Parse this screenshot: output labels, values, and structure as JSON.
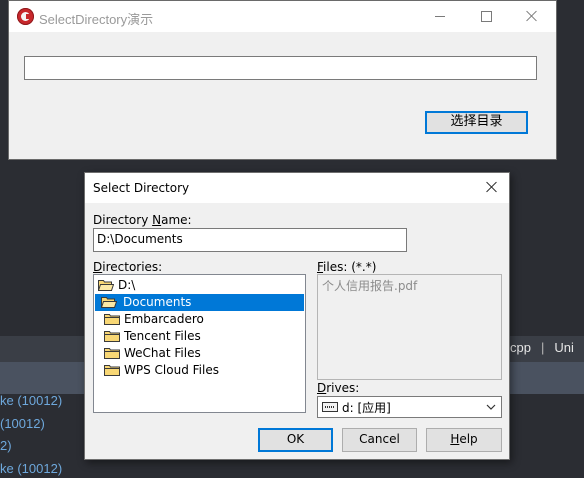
{
  "main_window": {
    "title": "SelectDirectory演示",
    "edit_value": "",
    "button_label": "选择目录"
  },
  "dialog": {
    "title": "Select Directory",
    "directory_name_label": {
      "pre": "Directory ",
      "key": "N",
      "post": "ame:"
    },
    "directory_name_value": "D:\\Documents",
    "directories_label": {
      "key": "D",
      "post": "irectories:"
    },
    "files_label": {
      "key": "F",
      "post": "iles: (*.*)"
    },
    "directories": [
      {
        "label": "D:\\",
        "icon": "open-folder-icon",
        "level": 0,
        "selected": false
      },
      {
        "label": "Documents",
        "icon": "open-folder-icon",
        "level": 1,
        "selected": true
      },
      {
        "label": "Embarcadero",
        "icon": "folder-icon",
        "level": 1,
        "selected": false
      },
      {
        "label": "Tencent Files",
        "icon": "folder-icon",
        "level": 1,
        "selected": false
      },
      {
        "label": "WeChat Files",
        "icon": "folder-icon",
        "level": 1,
        "selected": false
      },
      {
        "label": "WPS Cloud Files",
        "icon": "folder-icon",
        "level": 1,
        "selected": false
      }
    ],
    "files": [
      "个人信用报告.pdf"
    ],
    "drives_label": {
      "key": "D",
      "post": "rives:"
    },
    "drive_value": "d: [应用]",
    "ok_label": "OK",
    "cancel_label": "Cancel",
    "help_label": {
      "key": "H",
      "post": "elp"
    }
  },
  "background": {
    "tabs": [
      "cpp",
      "Uni"
    ],
    "list": [
      "ke (10012)",
      "(10012)",
      "2)",
      "ke (10012)"
    ]
  },
  "colors": {
    "accent": "#0078d7",
    "folder": "#f8d775",
    "link": "#6ea8dc"
  }
}
